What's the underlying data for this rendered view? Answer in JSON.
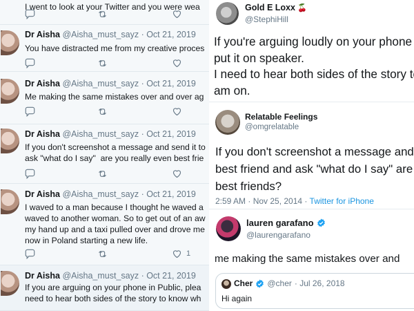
{
  "left_tweets": [
    {
      "name": "",
      "handle": "",
      "date": "",
      "text": "I went to look at your Twitter and you were wea",
      "replies": "",
      "retweets": "",
      "likes": ""
    },
    {
      "name": "Dr Aisha",
      "handle": "@Aisha_must_sayz",
      "date": "Oct 21, 2019",
      "text": "You have distracted me from my creative proces",
      "replies": "",
      "retweets": "",
      "likes": ""
    },
    {
      "name": "Dr Aisha",
      "handle": "@Aisha_must_sayz",
      "date": "Oct 21, 2019",
      "text": "Me making the same mistakes over and over ag",
      "replies": "",
      "retweets": "",
      "likes": ""
    },
    {
      "name": "Dr Aisha",
      "handle": "@Aisha_must_sayz",
      "date": "Oct 21, 2019",
      "text": "If you don't screenshot a message and send it to\nask \"what do I say\"  are you really even best frie",
      "replies": "",
      "retweets": "",
      "likes": ""
    },
    {
      "name": "Dr Aisha",
      "handle": "@Aisha_must_sayz",
      "date": "Oct 21, 2019",
      "text": "I waved to a man because I thought he waved a\nwaved to another woman. So to get out of an aw\nmy hand up and a taxi pulled over and drove me\nnow in Poland starting a new life.",
      "replies": "",
      "retweets": "",
      "likes": "1"
    },
    {
      "name": "Dr Aisha",
      "handle": "@Aisha_must_sayz",
      "date": "Oct 21, 2019",
      "text": "If you are arguing on your phone in Public, plea\nneed to hear both sides of the story to know wh",
      "replies": "",
      "retweets": "",
      "likes": ""
    }
  ],
  "right_top": {
    "name": "Gold E Loxx",
    "emoji": "🍒",
    "handle": "@StephiHill",
    "text": "If you're arguing loudly on your phone in\nput it on speaker.\nI need to hear both sides of the story to k\nam on."
  },
  "right_mid": {
    "name": "Relatable Feelings",
    "handle": "@omgrelatable",
    "text": "If you don't screenshot a message and\nbest friend and ask \"what do I say\" are\nbest friends?",
    "timestamp": "2:59 AM · Nov 25, 2014 · ",
    "source": "Twitter for iPhone"
  },
  "right_bot": {
    "name": "lauren garafano",
    "handle": "@laurengarafano",
    "text": "me making the same mistakes over and",
    "quote": {
      "name": "Cher",
      "handle": "@cher",
      "date": "· Jul 26, 2018",
      "text": "Hi again"
    }
  },
  "colors": {
    "verified": "#1da1f2",
    "link": "#1b95e0",
    "muted": "#657786",
    "like_active": "#e0245e"
  },
  "icons": {
    "reply": "reply-icon",
    "retweet": "retweet-icon",
    "like": "heart-icon",
    "share": "share-icon",
    "verified": "verified-badge-icon"
  }
}
